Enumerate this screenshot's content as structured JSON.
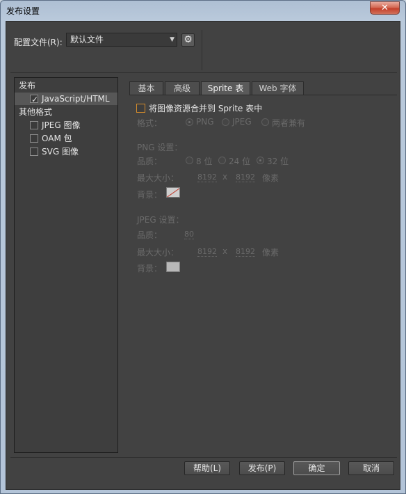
{
  "window": {
    "title": "发布设置",
    "close_glyph": "✕"
  },
  "header": {
    "profile_label": "配置文件(R):",
    "profile_value": "默认文件",
    "dropdown_glyph": "▼",
    "gear_glyph": "⚙"
  },
  "tree": {
    "publish_label": "发布",
    "js_html_label": "JavaScript/HTML",
    "js_html_checked": true,
    "other_formats_label": "其他格式",
    "jpeg_label": "JPEG 图像",
    "oam_label": "OAM 包",
    "svg_label": "SVG 图像",
    "tick_glyph": "✓"
  },
  "tabs": {
    "basic": "基本",
    "advanced": "高级",
    "sprite": "Sprite 表",
    "webfont": "Web 字体"
  },
  "sprite": {
    "merge_label": "将图像资源合并到 Sprite 表中",
    "format_label": "格式：",
    "format_options": [
      "PNG",
      "JPEG",
      "两者兼有"
    ],
    "format_selected": "PNG",
    "png_settings_label": "PNG 设置：",
    "png_quality_label": "品质：",
    "png_quality_options": [
      "8 位",
      "24 位",
      "32 位"
    ],
    "png_quality_selected": "32 位",
    "png_max_size_label": "最大大小：",
    "png_width": "8192",
    "png_x": "x",
    "png_height": "8192",
    "png_unit": "像素",
    "png_bg_label": "背景：",
    "jpeg_settings_label": "JPEG 设置：",
    "jpeg_quality_label": "品质：",
    "jpeg_quality_value": "80",
    "jpeg_max_size_label": "最大大小：",
    "jpeg_width": "8192",
    "jpeg_x": "x",
    "jpeg_height": "8192",
    "jpeg_unit": "像素",
    "jpeg_bg_label": "背景：",
    "jpeg_bg_color": "#b8b8b8"
  },
  "buttons": {
    "help": "帮助(L)",
    "publish": "发布(P)",
    "ok": "确定",
    "cancel": "取消"
  }
}
